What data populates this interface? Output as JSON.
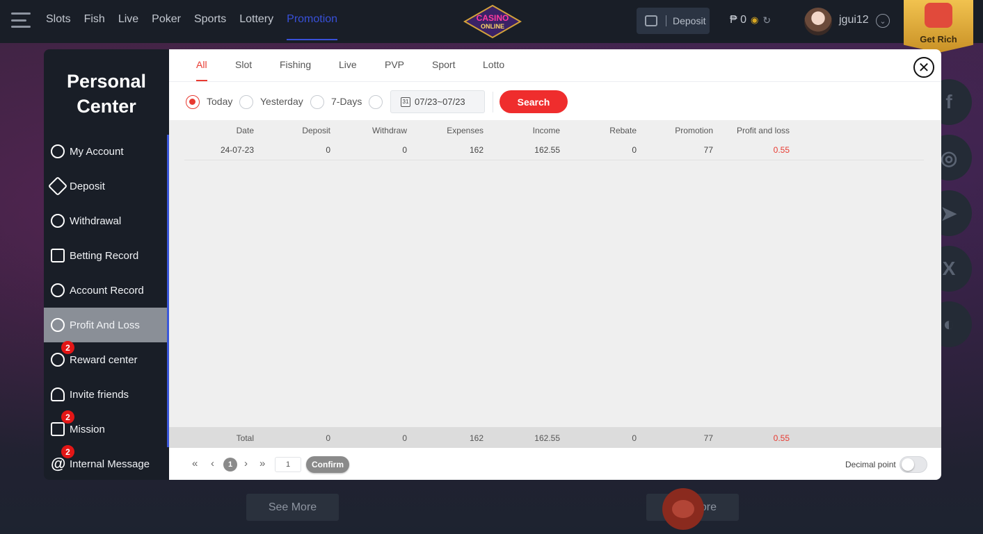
{
  "nav": {
    "links": [
      "Slots",
      "Fish",
      "Live",
      "Poker",
      "Sports",
      "Lottery",
      "Promotion"
    ],
    "active": "Promotion",
    "logo_line1": "CASINO",
    "logo_line2": "ONLINE",
    "deposit_label": "Deposit",
    "balance": "₱ 0",
    "username": "jgui12",
    "get_rich": "Get Rich"
  },
  "sidebar": {
    "title_line1": "Personal",
    "title_line2": "Center",
    "items": [
      {
        "label": "My Account",
        "icon": "account-icon",
        "badge": ""
      },
      {
        "label": "Deposit",
        "icon": "deposit-icon",
        "badge": ""
      },
      {
        "label": "Withdrawal",
        "icon": "withdrawal-icon",
        "badge": ""
      },
      {
        "label": "Betting Record",
        "icon": "betting-record-icon",
        "badge": ""
      },
      {
        "label": "Account Record",
        "icon": "account-record-icon",
        "badge": ""
      },
      {
        "label": "Profit And Loss",
        "icon": "profit-loss-icon",
        "badge": ""
      },
      {
        "label": "Reward center",
        "icon": "reward-icon",
        "badge": "2"
      },
      {
        "label": "Invite friends",
        "icon": "invite-icon",
        "badge": ""
      },
      {
        "label": "Mission",
        "icon": "gift-icon",
        "badge": "2"
      },
      {
        "label": "Internal Message",
        "icon": "at-icon",
        "badge": "2"
      }
    ],
    "active": "Profit And Loss"
  },
  "tabs": [
    "All",
    "Slot",
    "Fishing",
    "Live",
    "PVP",
    "Sport",
    "Lotto"
  ],
  "active_tab": "All",
  "filters": {
    "options": [
      "Today",
      "Yesterday",
      "7-Days"
    ],
    "selected": "Today",
    "date_range": "07/23~07/23",
    "calendar_day": "31",
    "search_label": "Search"
  },
  "table": {
    "columns": [
      "Date",
      "Deposit",
      "Withdraw",
      "Expenses",
      "Income",
      "Rebate",
      "Promotion",
      "Profit and loss"
    ],
    "rows": [
      [
        "24-07-23",
        "0",
        "0",
        "162",
        "162.55",
        "0",
        "77",
        "0.55"
      ]
    ],
    "total": [
      "Total",
      "0",
      "0",
      "162",
      "162.55",
      "0",
      "77",
      "0.55"
    ]
  },
  "pager": {
    "current_page": "1",
    "page_input": "1",
    "confirm_label": "Confirm",
    "decimal_label": "Decimal point",
    "decimal_on": false
  },
  "bottom": {
    "see_more": "See More",
    "see_more_2": "ore"
  },
  "colors": {
    "accent": "#e83a31",
    "nav_active": "#3850d8",
    "sidebar_bg": "#191e27"
  }
}
